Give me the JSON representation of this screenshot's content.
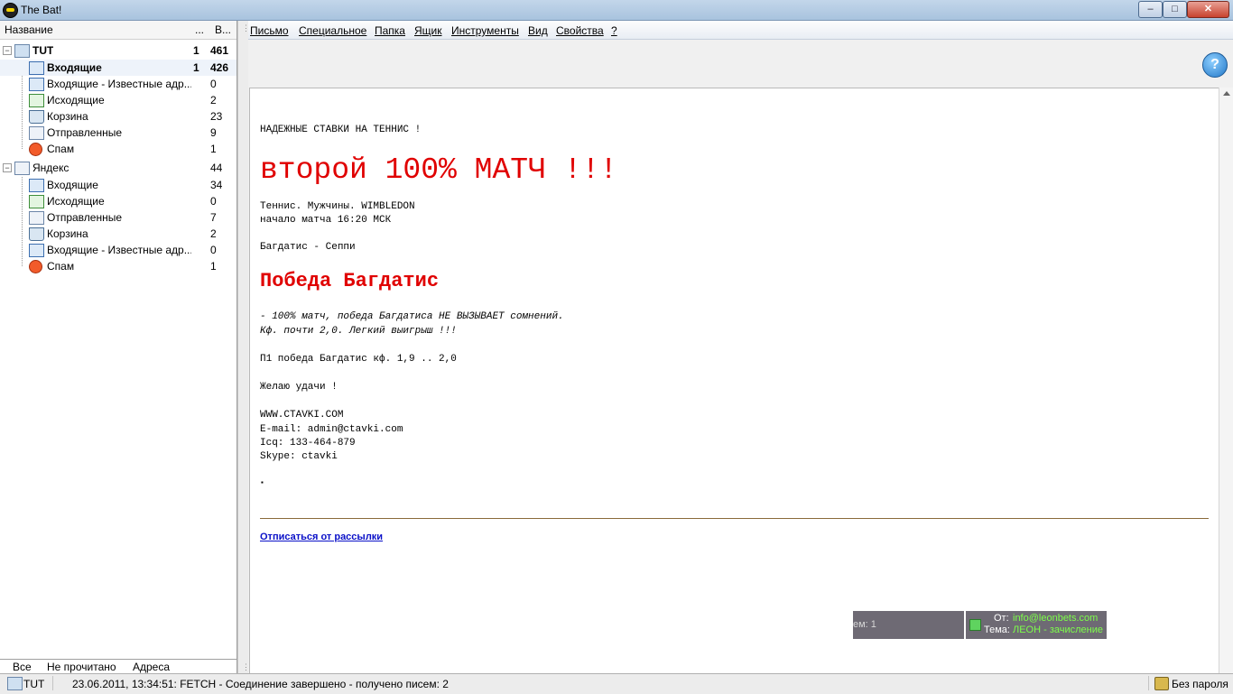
{
  "window": {
    "title": "The Bat!",
    "min": "‒",
    "max": "□",
    "close": "✕"
  },
  "folders": {
    "col_name": "Название",
    "col_unread": "...",
    "col_total": "В...",
    "accounts": [
      {
        "name": "TUT",
        "unread": "1",
        "total": "461",
        "folders": [
          {
            "name": "Входящие",
            "unread": "1",
            "total": "426",
            "icon": "inbox-icon"
          },
          {
            "name": "Входящие - Известные адр...",
            "unread": "",
            "total": "0",
            "icon": "inbox-icon"
          },
          {
            "name": "Исходящие",
            "unread": "",
            "total": "2",
            "icon": "outbox-icon"
          },
          {
            "name": "Корзина",
            "unread": "",
            "total": "23",
            "icon": "trash-icon"
          },
          {
            "name": "Отправленные",
            "unread": "",
            "total": "9",
            "icon": "sent-icon"
          },
          {
            "name": "Спам",
            "unread": "",
            "total": "1",
            "icon": "spam-icon"
          }
        ]
      },
      {
        "name": "Яндекс",
        "unread": "",
        "total": "44",
        "folders": [
          {
            "name": "Входящие",
            "unread": "",
            "total": "34",
            "icon": "inbox-icon"
          },
          {
            "name": "Исходящие",
            "unread": "",
            "total": "0",
            "icon": "outbox-icon"
          },
          {
            "name": "Отправленные",
            "unread": "",
            "total": "7",
            "icon": "sent-icon"
          },
          {
            "name": "Корзина",
            "unread": "",
            "total": "2",
            "icon": "trash-icon"
          },
          {
            "name": "Входящие - Известные адр...",
            "unread": "",
            "total": "0",
            "icon": "inbox-icon"
          },
          {
            "name": "Спам",
            "unread": "",
            "total": "1",
            "icon": "spam-icon"
          }
        ]
      }
    ],
    "tabs": [
      "Все",
      "Не прочитано",
      "Адреса"
    ]
  },
  "menu": [
    "Письмо",
    "Специальное",
    "Папка",
    "Ящик",
    "Инструменты",
    "Вид",
    "Свойства",
    "?"
  ],
  "message": {
    "line1": "НАДЕЖНЫЕ СТАВКИ НА ТЕННИС !",
    "headline": "второй 100% МАТЧ !!!",
    "line3": "Теннис. Мужчины. WIMBLEDON",
    "line4": "начало матча 16:20 МСК",
    "line5": "Багдатис - Сеппи",
    "winner": "Победа Багдатис",
    "italic1": "- 100% матч, победа Багдатиса НЕ ВЫЗЫВАЕТ сомнений.",
    "italic2": "Кф. почти 2,0. Легкий выигрыш !!!",
    "line8": "П1 победа Багдатис кф. 1,9 .. 2,0",
    "line9": "Желаю удачи !",
    "line10": "WWW.CTAVKI.COM",
    "line11": "E-mail: admin@ctavki.com",
    "line12": "Icq: 133-464-879",
    "line13": "Skype: ctavki",
    "bullet": "▪",
    "unsubscribe": "Отписаться от рассылки"
  },
  "notification": {
    "left_text": "ем: 1",
    "from_label": "От:",
    "from_value": "info@leonbets.com",
    "subject_label": "Тема:",
    "subject_value": "ЛЕОН - зачисление"
  },
  "statusbar": {
    "account": "TUT",
    "log": "23.06.2011, 13:34:51: FETCH - Соединение завершено - получено писем: 2",
    "security": "Без пароля"
  }
}
